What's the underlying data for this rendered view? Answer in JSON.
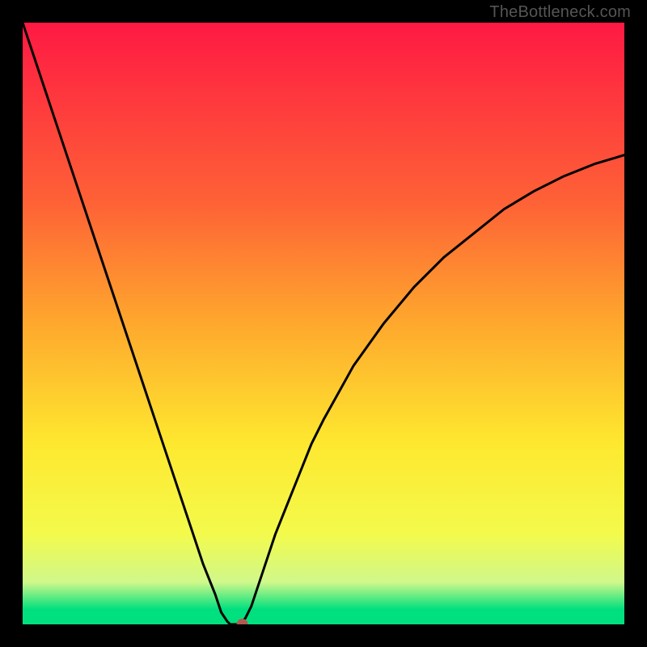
{
  "watermark": "TheBottleneck.com",
  "chart_data": {
    "type": "line",
    "title": "",
    "xlabel": "",
    "ylabel": "",
    "x": [
      0.0,
      0.02,
      0.04,
      0.06,
      0.08,
      0.1,
      0.12,
      0.14,
      0.16,
      0.18,
      0.2,
      0.22,
      0.24,
      0.26,
      0.28,
      0.3,
      0.32,
      0.33,
      0.34,
      0.345,
      0.35,
      0.355,
      0.36,
      0.365,
      0.37,
      0.38,
      0.4,
      0.42,
      0.44,
      0.46,
      0.48,
      0.5,
      0.55,
      0.6,
      0.65,
      0.7,
      0.75,
      0.8,
      0.85,
      0.9,
      0.95,
      1.0
    ],
    "values": [
      1.0,
      0.94,
      0.88,
      0.82,
      0.76,
      0.7,
      0.64,
      0.58,
      0.52,
      0.46,
      0.4,
      0.34,
      0.28,
      0.22,
      0.16,
      0.1,
      0.05,
      0.02,
      0.005,
      0.0,
      0.0,
      0.0,
      0.0,
      0.005,
      0.01,
      0.03,
      0.09,
      0.15,
      0.2,
      0.25,
      0.3,
      0.34,
      0.43,
      0.5,
      0.56,
      0.61,
      0.65,
      0.69,
      0.72,
      0.745,
      0.765,
      0.78
    ],
    "xlim": [
      0,
      1
    ],
    "ylim": [
      0,
      1
    ],
    "grid": false,
    "marker": {
      "x": 0.365,
      "y": 0.0,
      "color": "#b35a50"
    },
    "background_gradient": {
      "stops": [
        {
          "pos": 0.0,
          "color": "#fe1943"
        },
        {
          "pos": 0.3,
          "color": "#fe6236"
        },
        {
          "pos": 0.5,
          "color": "#fea82d"
        },
        {
          "pos": 0.7,
          "color": "#fee82f"
        },
        {
          "pos": 0.85,
          "color": "#f3fa4c"
        },
        {
          "pos": 0.93,
          "color": "#d0f88a"
        },
        {
          "pos": 0.975,
          "color": "#00e07e"
        },
        {
          "pos": 1.0,
          "color": "#00e07e"
        }
      ]
    }
  }
}
